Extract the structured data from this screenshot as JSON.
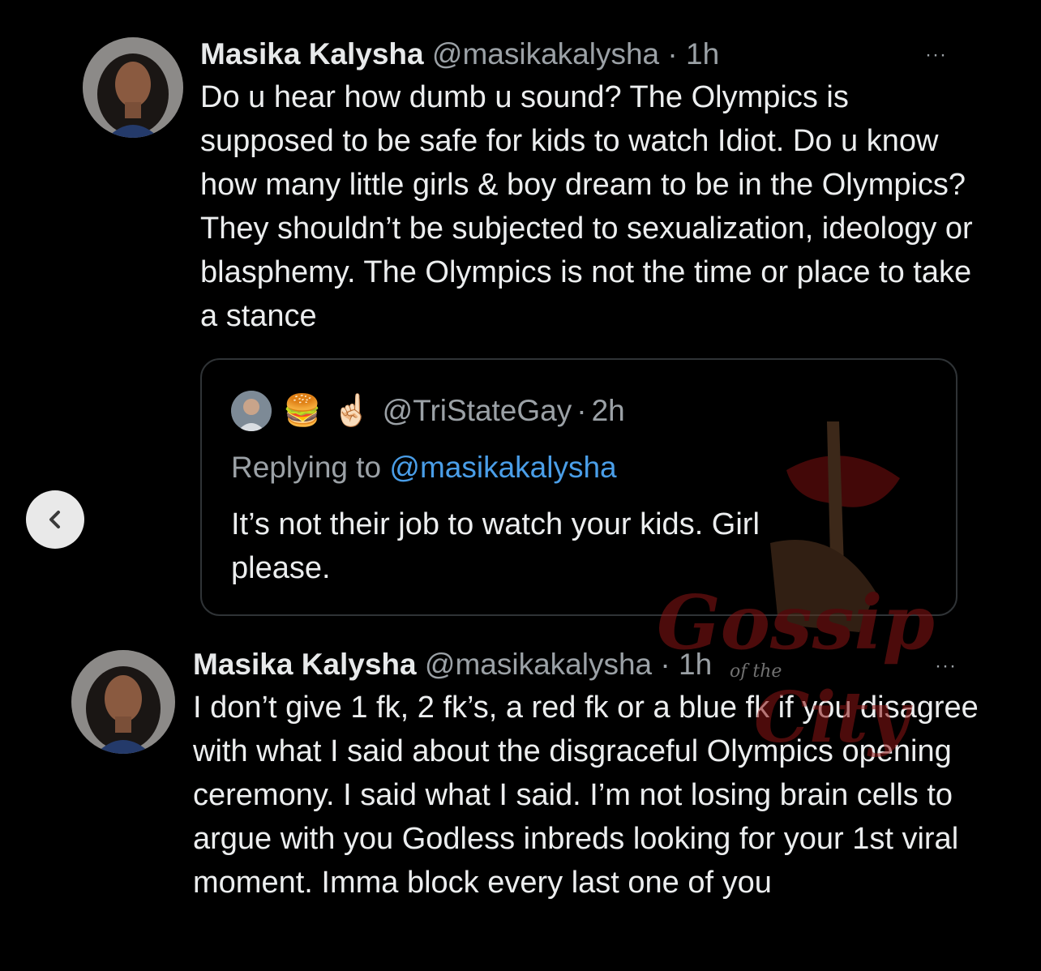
{
  "tweets": [
    {
      "name": "Masika Kalysha",
      "handle": "@masikakalysha",
      "separator": "·",
      "time": "1h",
      "text": "Do u hear how dumb u sound? The Olympics is supposed to be safe for kids to watch Idiot. Do u know how many little girls & boy dream to be in the Olympics? They shouldn’t be subjected to sexualization, ideology or blasphemy. The Olympics is not the time or place to take a stance",
      "more": "···"
    },
    {
      "name": "Masika Kalysha",
      "handle": "@masikakalysha",
      "separator": "·",
      "time": "1h",
      "text": "I don’t give 1 fk, 2 fk’s, a red fk or a blue fk if you disagree with what I said about the disgraceful Olympics opening ceremony. I said what I said. I’m not losing brain cells to argue with you Godless inbreds looking for your 1st viral moment. Imma block every last one of you",
      "more": "···"
    }
  ],
  "quote": {
    "emojis": [
      "🍔",
      "☝🏻"
    ],
    "handle": "@TriStateGay",
    "separator": "·",
    "time": "2h",
    "replying_prefix": "Replying to",
    "replying_handle": "@masikakalysha",
    "text": "It’s not their job to watch your kids. Girl please."
  },
  "watermark": {
    "line1": "Gossip",
    "line2": "of the",
    "line3": "City"
  },
  "colors": {
    "background": "#000000",
    "text": "#e7e9ea",
    "secondary": "#9ba1a6",
    "link": "#4a9ee8",
    "card_border": "#2f3336"
  }
}
